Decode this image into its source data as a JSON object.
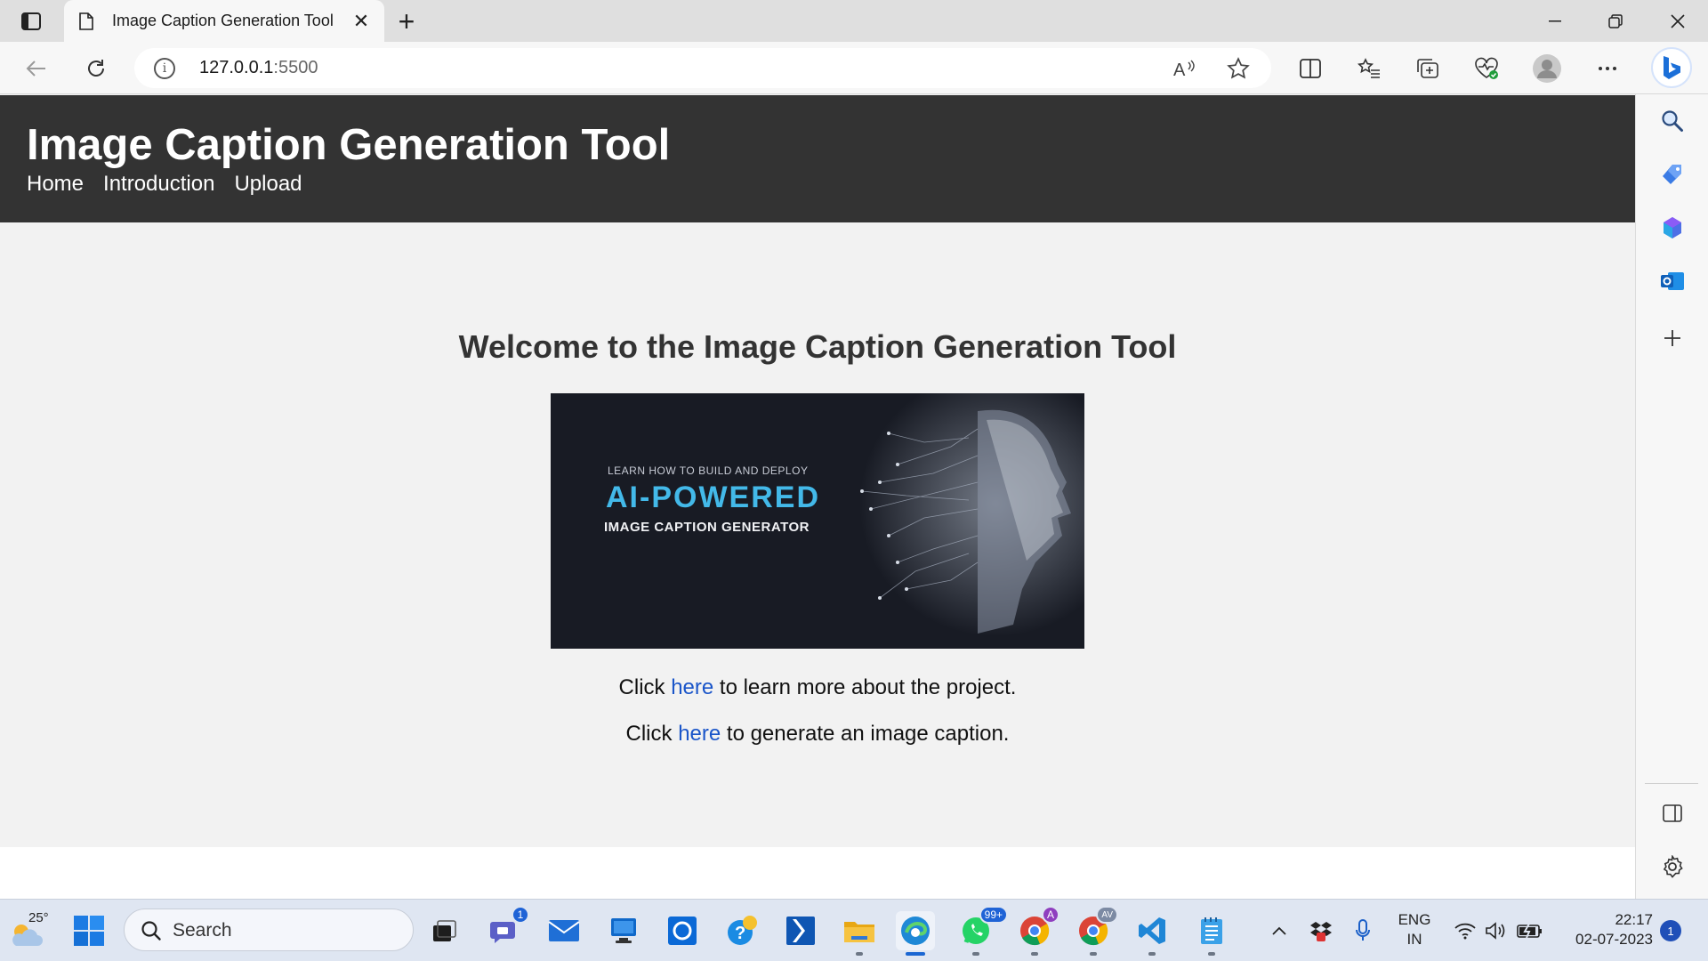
{
  "browser": {
    "tab_title": "Image Caption Generation Tool",
    "url_host": "127.0.0.1",
    "url_port": ":5500",
    "new_tab_glyph": "+",
    "close_glyph": "✕"
  },
  "site": {
    "title": "Image Caption Generation Tool",
    "nav": [
      "Home",
      "Introduction",
      "Upload"
    ],
    "welcome": "Welcome to the Image Caption Generation Tool",
    "banner": {
      "small": "LEARN HOW TO BUILD AND DEPLOY",
      "big": "AI-POWERED",
      "sub": "IMAGE CAPTION GENERATOR"
    },
    "para1": {
      "before": "Click ",
      "link": "here",
      "after": " to learn more about the project."
    },
    "para2": {
      "before": "Click ",
      "link": "here",
      "after": " to generate an image caption."
    }
  },
  "taskbar": {
    "weather_temp": "25°",
    "search_label": "Search",
    "teams_badge": "1",
    "whatsapp_badge": "99+",
    "chrome_a_badge": "A",
    "chrome_av_badge": "AV",
    "lang_line1": "ENG",
    "lang_line2": "IN",
    "time": "22:17",
    "date": "02-07-2023",
    "notifications": "1"
  },
  "colors": {
    "header_bg": "#333333",
    "link": "#1a55c9",
    "banner_accent": "#43b9e9",
    "taskbar_bg": "#dfe6f2"
  },
  "icons": [
    "tab-actions-icon",
    "page-icon",
    "back-arrow-icon",
    "refresh-icon",
    "info-icon",
    "read-aloud-icon",
    "favorite-star-icon",
    "split-screen-icon",
    "favorites-icon",
    "collections-icon",
    "browser-essentials-icon",
    "profile-avatar-icon",
    "more-icon",
    "bing-icon",
    "search-icon",
    "shopping-tag-icon",
    "copilot-icon",
    "outlook-icon",
    "add-icon",
    "sidebar-panel-icon",
    "settings-gear-icon",
    "windows-start-icon"
  ]
}
